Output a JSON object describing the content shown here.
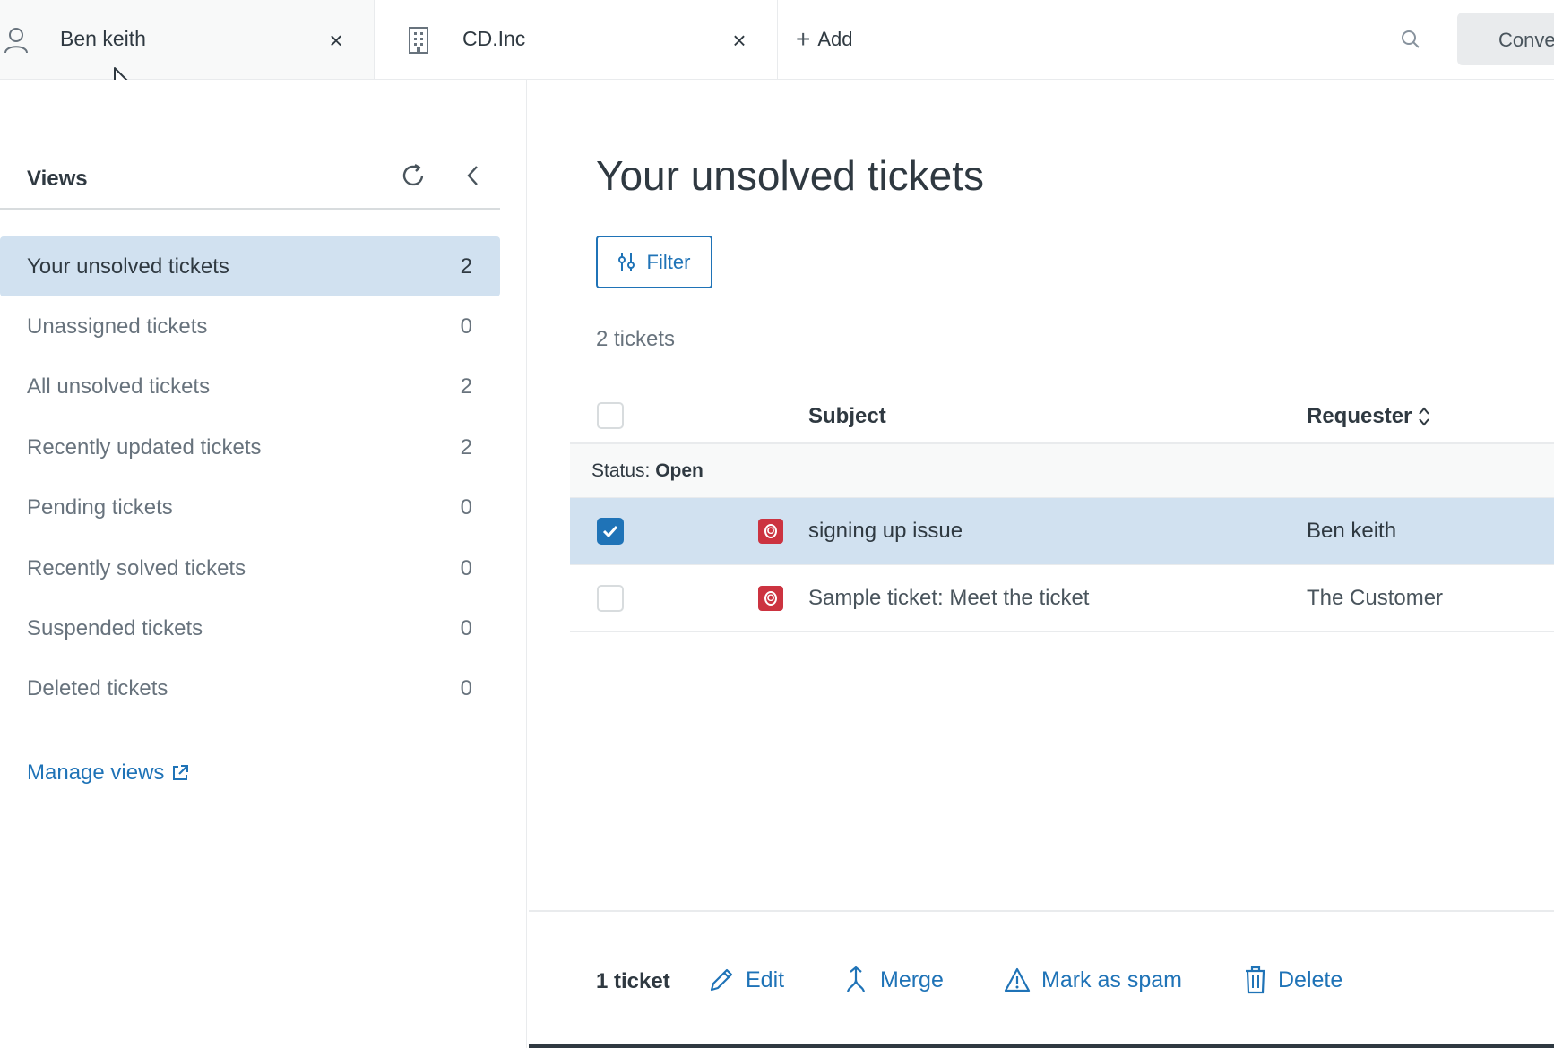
{
  "tabs": [
    {
      "label": "Ben keith",
      "icon": "user-icon"
    },
    {
      "label": "CD.Inc",
      "icon": "building-icon"
    }
  ],
  "toolbar": {
    "add_label": "Add",
    "conversations_label": "Conve"
  },
  "sidebar": {
    "title": "Views",
    "items": [
      {
        "label": "Your unsolved tickets",
        "count": "2"
      },
      {
        "label": "Unassigned tickets",
        "count": "0"
      },
      {
        "label": "All unsolved tickets",
        "count": "2"
      },
      {
        "label": "Recently updated tickets",
        "count": "2"
      },
      {
        "label": "Pending tickets",
        "count": "0"
      },
      {
        "label": "Recently solved tickets",
        "count": "0"
      },
      {
        "label": "Suspended tickets",
        "count": "0"
      },
      {
        "label": "Deleted tickets",
        "count": "0"
      }
    ],
    "manage_views": "Manage views"
  },
  "main": {
    "title": "Your unsolved tickets",
    "filter_label": "Filter",
    "ticket_count": "2 tickets",
    "columns": {
      "subject": "Subject",
      "requester": "Requester"
    },
    "group": {
      "prefix": "Status:",
      "value": "Open"
    },
    "rows": [
      {
        "status": "O",
        "subject": "signing up issue",
        "requester": "Ben keith",
        "selected": true
      },
      {
        "status": "O",
        "subject": "Sample ticket: Meet the ticket",
        "requester": "The Customer",
        "selected": false
      }
    ]
  },
  "bulk_actions": {
    "selected_count": "1 ticket",
    "edit": "Edit",
    "merge": "Merge",
    "spam": "Mark as spam",
    "delete": "Delete"
  },
  "colors": {
    "accent": "#1f73b7",
    "selected_bg": "#d1e1f0",
    "status_open": "#cc3340"
  }
}
